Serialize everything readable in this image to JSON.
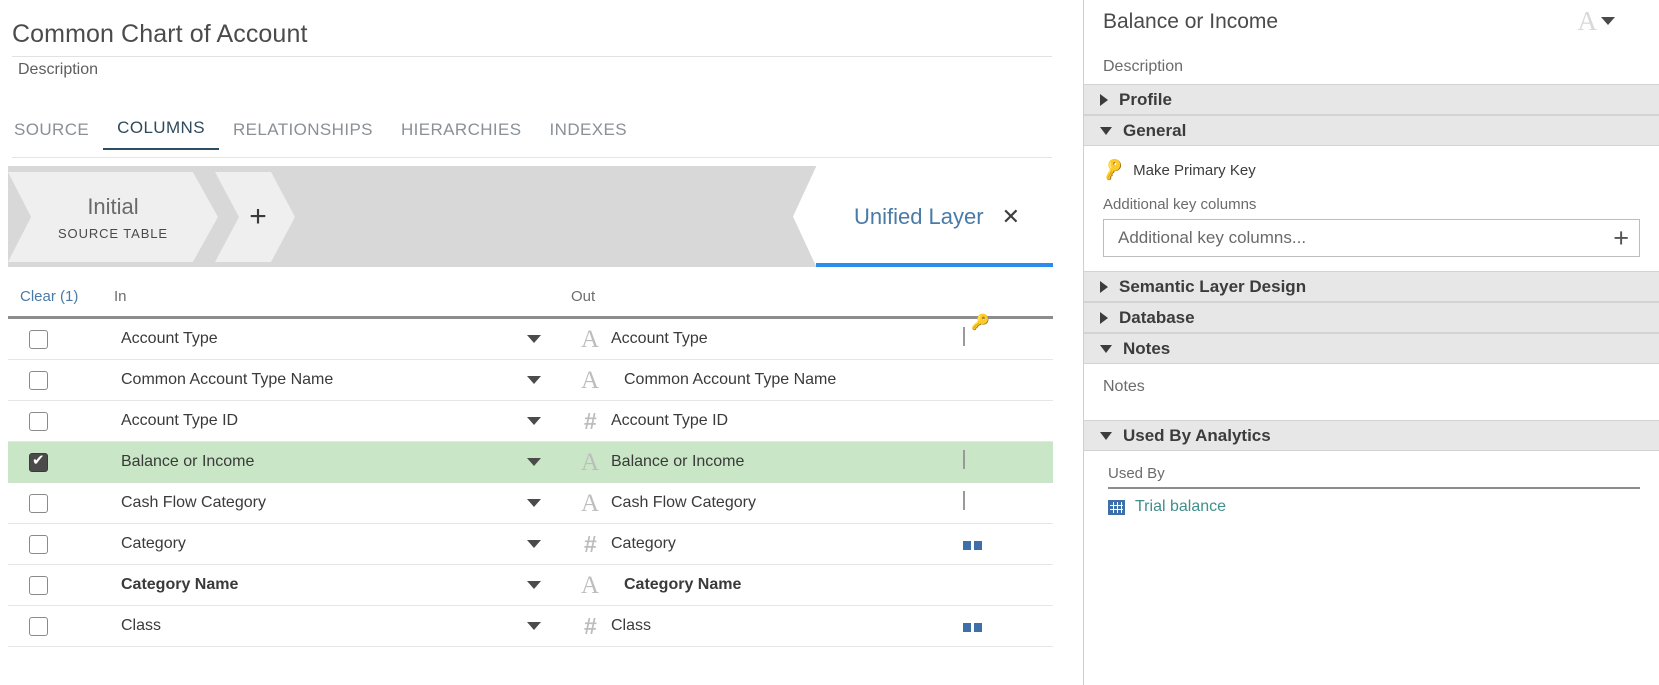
{
  "page": {
    "title": "Common Chart of Account",
    "description_placeholder": "Description"
  },
  "tabs": [
    {
      "label": "SOURCE",
      "active": false
    },
    {
      "label": "COLUMNS",
      "active": true
    },
    {
      "label": "RELATIONSHIPS",
      "active": false
    },
    {
      "label": "HIERARCHIES",
      "active": false
    },
    {
      "label": "INDEXES",
      "active": false
    }
  ],
  "layer_bar": {
    "initial": {
      "title": "Initial",
      "subtitle": "SOURCE TABLE"
    },
    "add_label": "+",
    "unified": {
      "label": "Unified Layer",
      "close": "✕"
    }
  },
  "table": {
    "clear_label": "Clear (1)",
    "col_in": "In",
    "col_out": "Out",
    "rows": [
      {
        "checked": false,
        "in": "Account Type",
        "out": "Account Type",
        "type": "A",
        "bold": false,
        "indent": false,
        "icon": "key-table-icon",
        "selected": false
      },
      {
        "checked": false,
        "in": "Common Account Type Name",
        "out": "Common Account Type Name",
        "type": "A",
        "bold": false,
        "indent": true,
        "icon": "none",
        "selected": false
      },
      {
        "checked": false,
        "in": "Account Type ID",
        "out": "Account Type ID",
        "type": "#",
        "bold": false,
        "indent": false,
        "icon": "tag-icon",
        "selected": false
      },
      {
        "checked": true,
        "in": "Balance or Income",
        "out": "Balance or Income",
        "type": "A",
        "bold": false,
        "indent": false,
        "icon": "table-icon",
        "selected": true
      },
      {
        "checked": false,
        "in": "Cash Flow Category",
        "out": "Cash Flow Category",
        "type": "A",
        "bold": false,
        "indent": false,
        "icon": "table-icon",
        "selected": false
      },
      {
        "checked": false,
        "in": "Category",
        "out": "Category",
        "type": "#",
        "bold": false,
        "indent": false,
        "icon": "blocks-icon",
        "selected": false
      },
      {
        "checked": false,
        "in": "Category Name",
        "out": "Category Name",
        "type": "A",
        "bold": true,
        "indent": true,
        "icon": "none",
        "selected": false
      },
      {
        "checked": false,
        "in": "Class",
        "out": "Class",
        "type": "#",
        "bold": false,
        "indent": false,
        "icon": "blocks-icon",
        "selected": false
      }
    ]
  },
  "inspector": {
    "title": "Balance or Income",
    "type_glyph": "A",
    "description_placeholder": "Description",
    "sections": {
      "profile": {
        "label": "Profile",
        "expanded": false
      },
      "general": {
        "label": "General",
        "expanded": true
      },
      "semantic": {
        "label": "Semantic Layer Design",
        "expanded": false
      },
      "database": {
        "label": "Database",
        "expanded": false
      },
      "notes": {
        "label": "Notes",
        "expanded": true
      },
      "used_by_analytics": {
        "label": "Used By Analytics",
        "expanded": true
      }
    },
    "general": {
      "make_primary_key": "Make Primary Key",
      "additional_key_columns_label": "Additional key columns",
      "additional_key_columns_value": "",
      "additional_key_columns_placeholder": "Additional key columns...",
      "add_button": "+"
    },
    "notes": {
      "placeholder": "Notes",
      "value": ""
    },
    "used_by": {
      "header": "Used By",
      "items": [
        {
          "label": "Trial balance"
        }
      ]
    }
  },
  "colors": {
    "accent_blue": "#2b8cf0",
    "link_blue": "#4a7ba8",
    "selected_row_green": "#c9e6c6",
    "icon_blue": "#3f6fa8",
    "teal_link": "#3f8f8a"
  }
}
